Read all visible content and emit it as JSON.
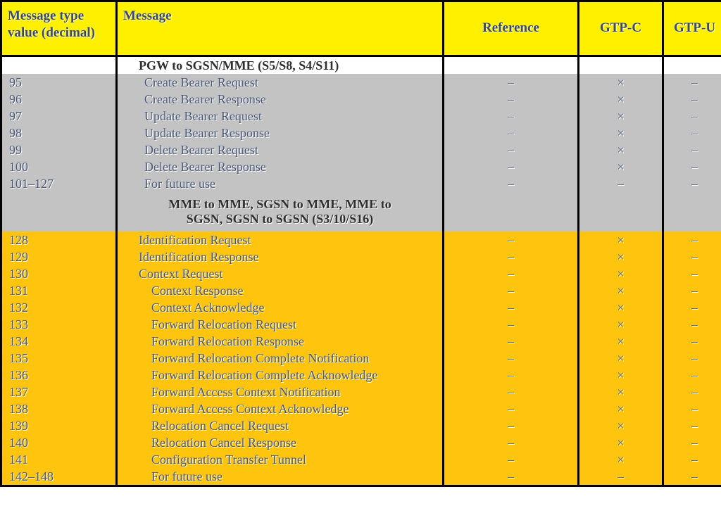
{
  "table": {
    "columns": [
      {
        "key": "value",
        "label": "Message type\nvalue (decimal)",
        "label_line1": "Message type",
        "label_line2": "value (decimal)",
        "align": "left"
      },
      {
        "key": "message",
        "label": "Message",
        "align": "left"
      },
      {
        "key": "reference",
        "label": "Reference",
        "align": "center"
      },
      {
        "key": "gtpc",
        "label": "GTP-C",
        "align": "center"
      },
      {
        "key": "gtpu",
        "label": "GTP-U",
        "align": "center"
      }
    ],
    "symbols": {
      "dash": "–",
      "cross": "×"
    },
    "colors": {
      "header_background": "#FFF000",
      "header_text": "#3A4A6B",
      "band_white": "#FFFFFF",
      "band_gray": "#C3C3C3",
      "band_orange": "#FFC40D",
      "body_text": "#49597A",
      "border": "#000000"
    },
    "rows": [
      {
        "band": "white",
        "kind": "section",
        "indent": 0,
        "value": "",
        "message": "PGW to SGSN/MME (S5/S8, S4/S11)",
        "reference": "",
        "gtpc": "",
        "gtpu": ""
      },
      {
        "band": "gray",
        "kind": "data",
        "indent": 1,
        "value": "95",
        "message": "Create Bearer Request",
        "reference": "–",
        "gtpc": "×",
        "gtpu": "–"
      },
      {
        "band": "gray",
        "kind": "data",
        "indent": 1,
        "value": "96",
        "message": "Create Bearer Response",
        "reference": "–",
        "gtpc": "×",
        "gtpu": "–"
      },
      {
        "band": "gray",
        "kind": "data",
        "indent": 1,
        "value": "97",
        "message": "Update Bearer Request",
        "reference": "–",
        "gtpc": "×",
        "gtpu": "–"
      },
      {
        "band": "gray",
        "kind": "data",
        "indent": 1,
        "value": "98",
        "message": "Update Bearer Response",
        "reference": "–",
        "gtpc": "×",
        "gtpu": "–"
      },
      {
        "band": "gray",
        "kind": "data",
        "indent": 1,
        "value": "99",
        "message": "Delete Bearer Request",
        "reference": "–",
        "gtpc": "×",
        "gtpu": "–"
      },
      {
        "band": "gray",
        "kind": "data",
        "indent": 1,
        "value": "100",
        "message": "Delete Bearer Response",
        "reference": "–",
        "gtpc": "×",
        "gtpu": "–"
      },
      {
        "band": "gray",
        "kind": "data",
        "indent": 1,
        "value": "101–127",
        "message": "For future use",
        "reference": "–",
        "gtpc": "–",
        "gtpu": "–"
      },
      {
        "band": "gray",
        "kind": "section2",
        "indent": 0,
        "value": "",
        "message": "MME to MME, SGSN to MME, MME to SGSN, SGSN to SGSN (S3/10/S16)",
        "message_line1": "MME to MME, SGSN to MME, MME to",
        "message_line2": "SGSN, SGSN to SGSN (S3/10/S16)",
        "reference": "",
        "gtpc": "",
        "gtpu": ""
      },
      {
        "band": "orange",
        "kind": "data",
        "indent": 0,
        "value": "128",
        "message": "Identification Request",
        "reference": "–",
        "gtpc": "×",
        "gtpu": "–"
      },
      {
        "band": "orange",
        "kind": "data",
        "indent": 0,
        "value": "129",
        "message": "Identification Response",
        "reference": "–",
        "gtpc": "×",
        "gtpu": "–"
      },
      {
        "band": "orange",
        "kind": "data",
        "indent": 0,
        "value": "130",
        "message": "Context Request",
        "reference": "–",
        "gtpc": "×",
        "gtpu": "–"
      },
      {
        "band": "orange",
        "kind": "data",
        "indent": 2,
        "value": "131",
        "message": "Context Response",
        "reference": "–",
        "gtpc": "×",
        "gtpu": "–"
      },
      {
        "band": "orange",
        "kind": "data",
        "indent": 2,
        "value": "132",
        "message": "Context Acknowledge",
        "reference": "–",
        "gtpc": "×",
        "gtpu": "–"
      },
      {
        "band": "orange",
        "kind": "data",
        "indent": 2,
        "value": "133",
        "message": "Forward Relocation Request",
        "reference": "–",
        "gtpc": "×",
        "gtpu": "–"
      },
      {
        "band": "orange",
        "kind": "data",
        "indent": 2,
        "value": "134",
        "message": "Forward Relocation Response",
        "reference": "–",
        "gtpc": "×",
        "gtpu": "–"
      },
      {
        "band": "orange",
        "kind": "data",
        "indent": 2,
        "value": "135",
        "message": "Forward Relocation Complete Notification",
        "reference": "–",
        "gtpc": "×",
        "gtpu": "–"
      },
      {
        "band": "orange",
        "kind": "data",
        "indent": 2,
        "value": "136",
        "message": "Forward Relocation Complete Acknowledge",
        "reference": "–",
        "gtpc": "×",
        "gtpu": "–"
      },
      {
        "band": "orange",
        "kind": "data",
        "indent": 2,
        "value": "137",
        "message": "Forward Access Context Notification",
        "reference": "–",
        "gtpc": "×",
        "gtpu": "–"
      },
      {
        "band": "orange",
        "kind": "data",
        "indent": 2,
        "value": "138",
        "message": "Forward Access Context Acknowledge",
        "reference": "–",
        "gtpc": "×",
        "gtpu": "–"
      },
      {
        "band": "orange",
        "kind": "data",
        "indent": 2,
        "value": "139",
        "message": "Relocation Cancel Request",
        "reference": "–",
        "gtpc": "×",
        "gtpu": "–"
      },
      {
        "band": "orange",
        "kind": "data",
        "indent": 2,
        "value": "140",
        "message": "Relocation Cancel Response",
        "reference": "–",
        "gtpc": "×",
        "gtpu": "–"
      },
      {
        "band": "orange",
        "kind": "data",
        "indent": 2,
        "value": "141",
        "message": "Configuration Transfer Tunnel",
        "reference": "–",
        "gtpc": "×",
        "gtpu": "–"
      },
      {
        "band": "orange",
        "kind": "data",
        "indent": 2,
        "value": "142–148",
        "message": "For future use",
        "reference": "–",
        "gtpc": "–",
        "gtpu": "–"
      }
    ]
  }
}
